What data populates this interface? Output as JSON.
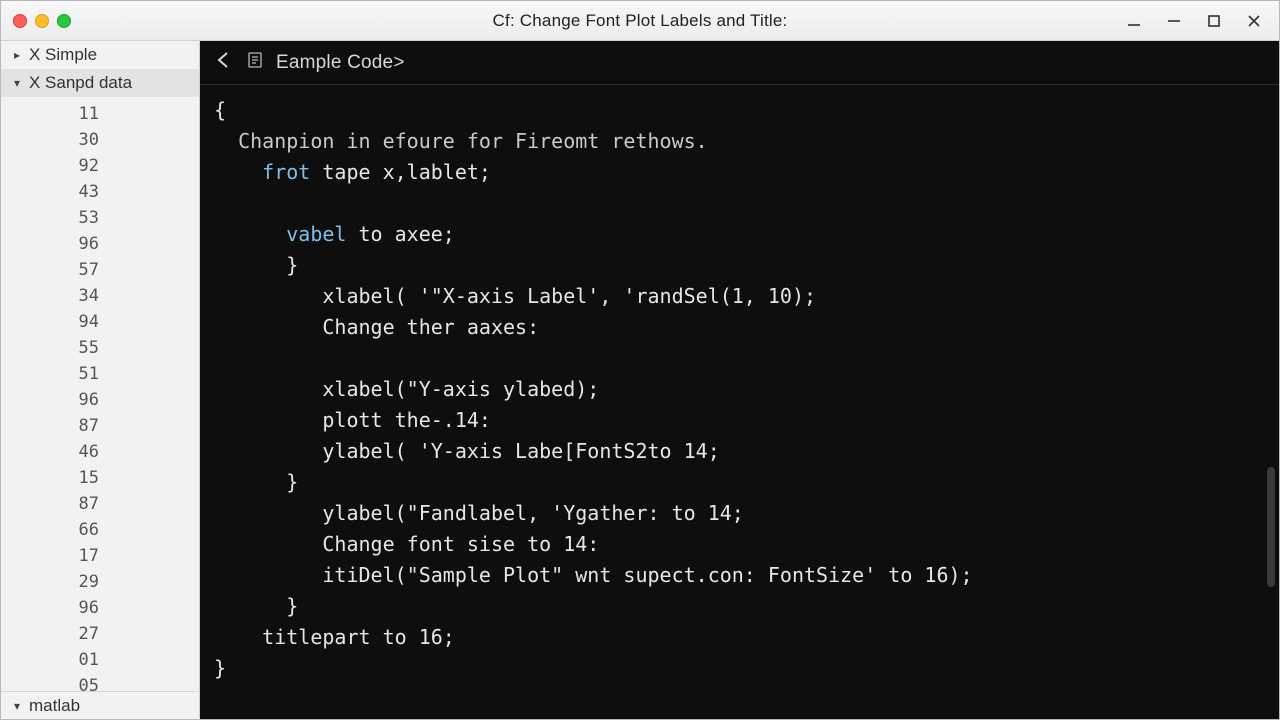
{
  "window": {
    "title": "Cf: Change Font Plot Labels and Title:"
  },
  "sidebar": {
    "items": [
      {
        "label": "X Simple",
        "chev": "▸"
      },
      {
        "label": "X Sanpd data",
        "chev": "▾"
      }
    ],
    "line_numbers": [
      "11",
      "30",
      "92",
      "43",
      "53",
      "96",
      "57",
      "34",
      "94",
      "55",
      "51",
      "96",
      "87",
      "46",
      "15",
      "87",
      "66",
      "17",
      "29",
      "96",
      "27",
      "01",
      "05"
    ],
    "bottom": {
      "label": "matlab",
      "chev": "▾"
    }
  },
  "breadcrumb": {
    "label": "Eample Code>"
  },
  "code": {
    "l1": "{",
    "l2_a": "Chanpion in efoure for Fireomt rethows.",
    "l3_kw": "frot",
    "l3_rest": " tape x,lablet;",
    "l4_kw": "vabel",
    "l4_rest": " to axee;",
    "l5": "}",
    "l6": "xlabel( '\"X-axis Label', 'randSel(1, 10);",
    "l7": "Change ther aaxes:",
    "l8": "xlabel(\"Y-axis ylabed);",
    "l9": "plott the-.14:",
    "l10": "ylabel( 'Y-axis Labe[FontS2to 14;",
    "l11": "}",
    "l12": "ylabel(\"Fandlabel, 'Ygather: to 14;",
    "l13": "Change font sise to 14:",
    "l14": "itiDel(\"Sample Plot\" wnt supect.con: FontSize' to 16);",
    "l15": "}",
    "l16": "titlepart to 16;",
    "l17": "}"
  }
}
